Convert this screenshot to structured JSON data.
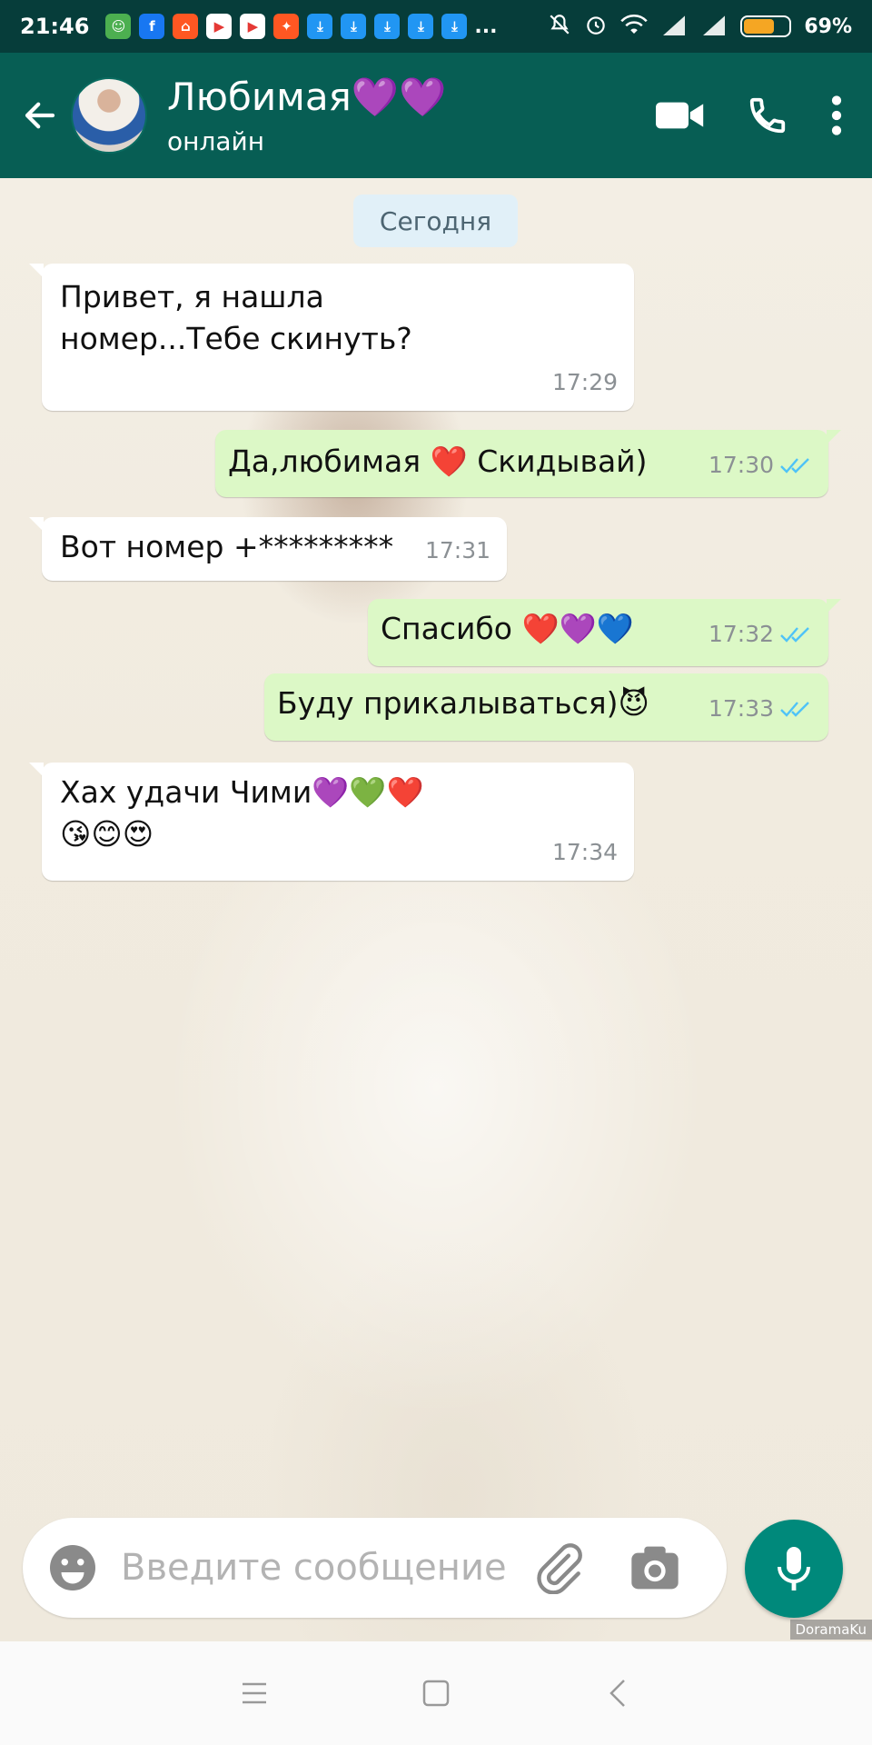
{
  "status_bar": {
    "time": "21:46",
    "battery_percent": "69%",
    "battery_level": 0.69,
    "notification_icons": [
      {
        "name": "android-app-icon",
        "color": "#4caf50",
        "glyph": "☺"
      },
      {
        "name": "facebook-icon",
        "color": "#1877f2",
        "glyph": "f"
      },
      {
        "name": "aliexpress-icon",
        "color": "#ff5722",
        "glyph": "⌂"
      },
      {
        "name": "youtube-icon",
        "color": "#ffffff",
        "glyph": "▶"
      },
      {
        "name": "youtube-icon",
        "color": "#ffffff",
        "glyph": "▶"
      },
      {
        "name": "app-icon",
        "color": "#ff5722",
        "glyph": "✦"
      },
      {
        "name": "download-icon",
        "color": "#2196f3",
        "glyph": "⤓"
      },
      {
        "name": "download-icon",
        "color": "#2196f3",
        "glyph": "⤓"
      },
      {
        "name": "download-icon",
        "color": "#2196f3",
        "glyph": "⤓"
      },
      {
        "name": "download-icon",
        "color": "#2196f3",
        "glyph": "⤓"
      },
      {
        "name": "download-icon",
        "color": "#2196f3",
        "glyph": "⤓"
      }
    ],
    "more": "..."
  },
  "header": {
    "name": "Любимая💜💜",
    "status": "онлайн"
  },
  "chat": {
    "date_label": "Сегодня",
    "messages": [
      {
        "dir": "in",
        "text": "Привет, я нашла\nномер...Тебе скинуть?",
        "time": "17:29"
      },
      {
        "dir": "out",
        "text": "Да,любимая ❤️ Скидывай)",
        "time": "17:30"
      },
      {
        "dir": "in",
        "text": "Вот номер +*********",
        "time": "17:31"
      },
      {
        "dir": "out",
        "text": "Спасибо ❤️💜💙",
        "time": "17:32"
      },
      {
        "dir": "out",
        "text": "Буду прикалываться)😈",
        "time": "17:33"
      },
      {
        "dir": "in",
        "text": "Хах удачи Чими💜💚❤️\n😘😊😍",
        "time": "17:34"
      }
    ]
  },
  "input": {
    "placeholder": "Введите сообщение"
  },
  "watermark": "DoramaKu",
  "colors": {
    "header": "#075e54",
    "status_bar": "#063d3a",
    "outgoing_bubble": "#dcf8c6",
    "incoming_bubble": "#ffffff",
    "read_ticks": "#4fc3f7",
    "mic_button": "#00897b"
  }
}
